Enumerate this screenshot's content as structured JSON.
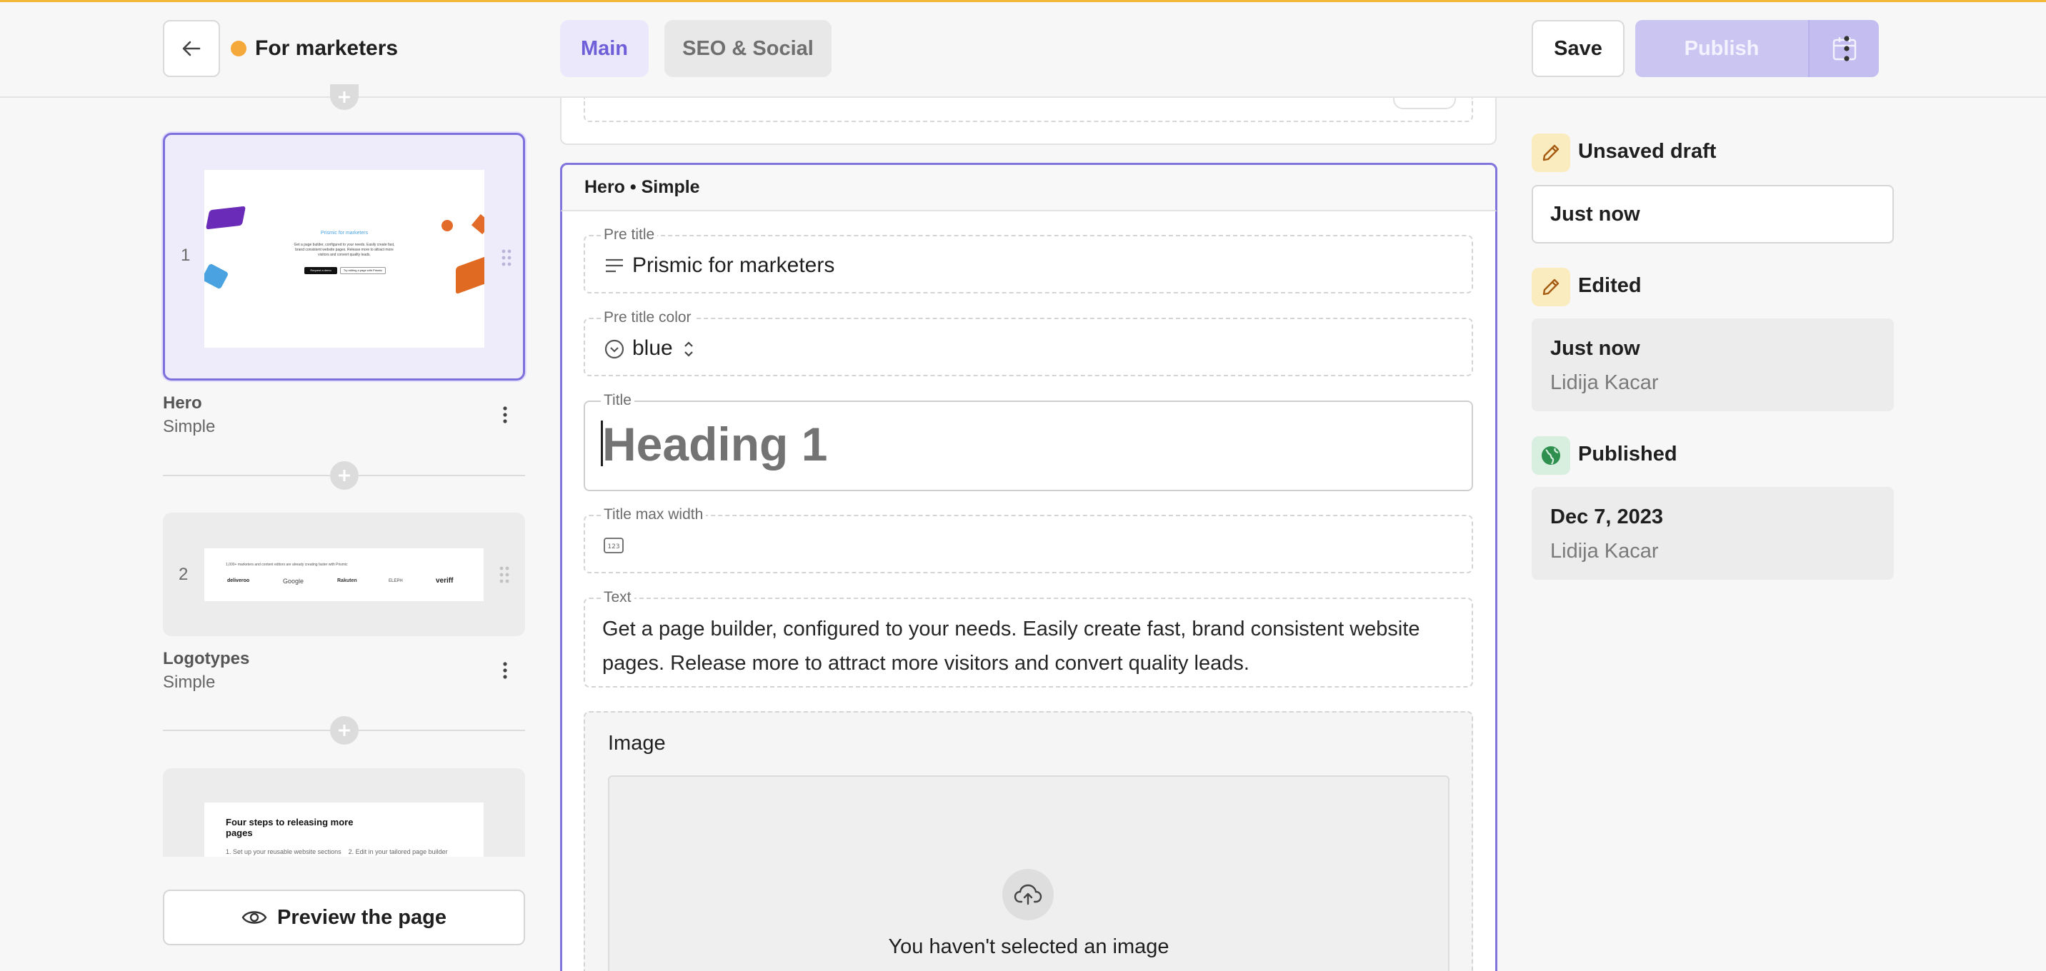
{
  "header": {
    "document_title": "For marketers",
    "status_color": "#f4a93a",
    "tabs": [
      {
        "label": "Main",
        "active": true
      },
      {
        "label": "SEO & Social",
        "active": false
      }
    ],
    "save_label": "Save",
    "publish_label": "Publish"
  },
  "slices": [
    {
      "index": "1",
      "name": "Hero",
      "variant": "Simple",
      "selected": true,
      "thumb_text": {
        "pretitle": "Prismic for marketers",
        "body": "Get a page builder, configured to your needs. Easily create fast, brand consistent website pages. Release more to attract more visitors and convert quality leads.",
        "button_primary": "Request a demo",
        "button_secondary": "Try editing a page with Prismic"
      }
    },
    {
      "index": "2",
      "name": "Logotypes",
      "variant": "Simple",
      "selected": false,
      "thumb_text": {
        "caption": "1,000+ marketers and content editors are already creating faster with Prismic",
        "logos": [
          "deliveroo",
          "Google",
          "Rakuten",
          "ELEPH",
          "veriff"
        ]
      }
    },
    {
      "index": "3",
      "thumb_text": {
        "title": "Four steps to releasing more pages",
        "steps": "1. Set up your reusable website sections    2. Edit in your tailored page builder"
      }
    }
  ],
  "preview_label": "Preview the page",
  "editor": {
    "slice_header": "Hero • Simple",
    "fields": {
      "pre_title": {
        "label": "Pre title",
        "value": "Prismic for marketers"
      },
      "pre_title_color": {
        "label": "Pre title color",
        "value": "blue"
      },
      "title": {
        "label": "Title",
        "placeholder": "Heading 1"
      },
      "title_max_width": {
        "label": "Title max width",
        "value": ""
      },
      "text": {
        "label": "Text",
        "value": "Get a page builder, configured to your needs. Easily create fast, brand consistent website pages. Release more to attract more visitors and convert quality leads."
      },
      "image": {
        "label": "Image",
        "empty_text": "You haven't selected an image"
      }
    }
  },
  "status_panel": {
    "draft": {
      "title": "Unsaved draft",
      "time": "Just now"
    },
    "edited": {
      "title": "Edited",
      "time": "Just now",
      "author": "Lidija Kacar"
    },
    "published": {
      "title": "Published",
      "date": "Dec 7, 2023",
      "author": "Lidija Kacar"
    }
  },
  "colors": {
    "accent": "#8174dc",
    "accent_light": "#ebe8fb",
    "publish_disabled": "#cbc5f2",
    "draft_icon_bg": "#fbecc0",
    "published_icon_bg": "#d8efe0",
    "published_icon": "#2f8f4e"
  }
}
